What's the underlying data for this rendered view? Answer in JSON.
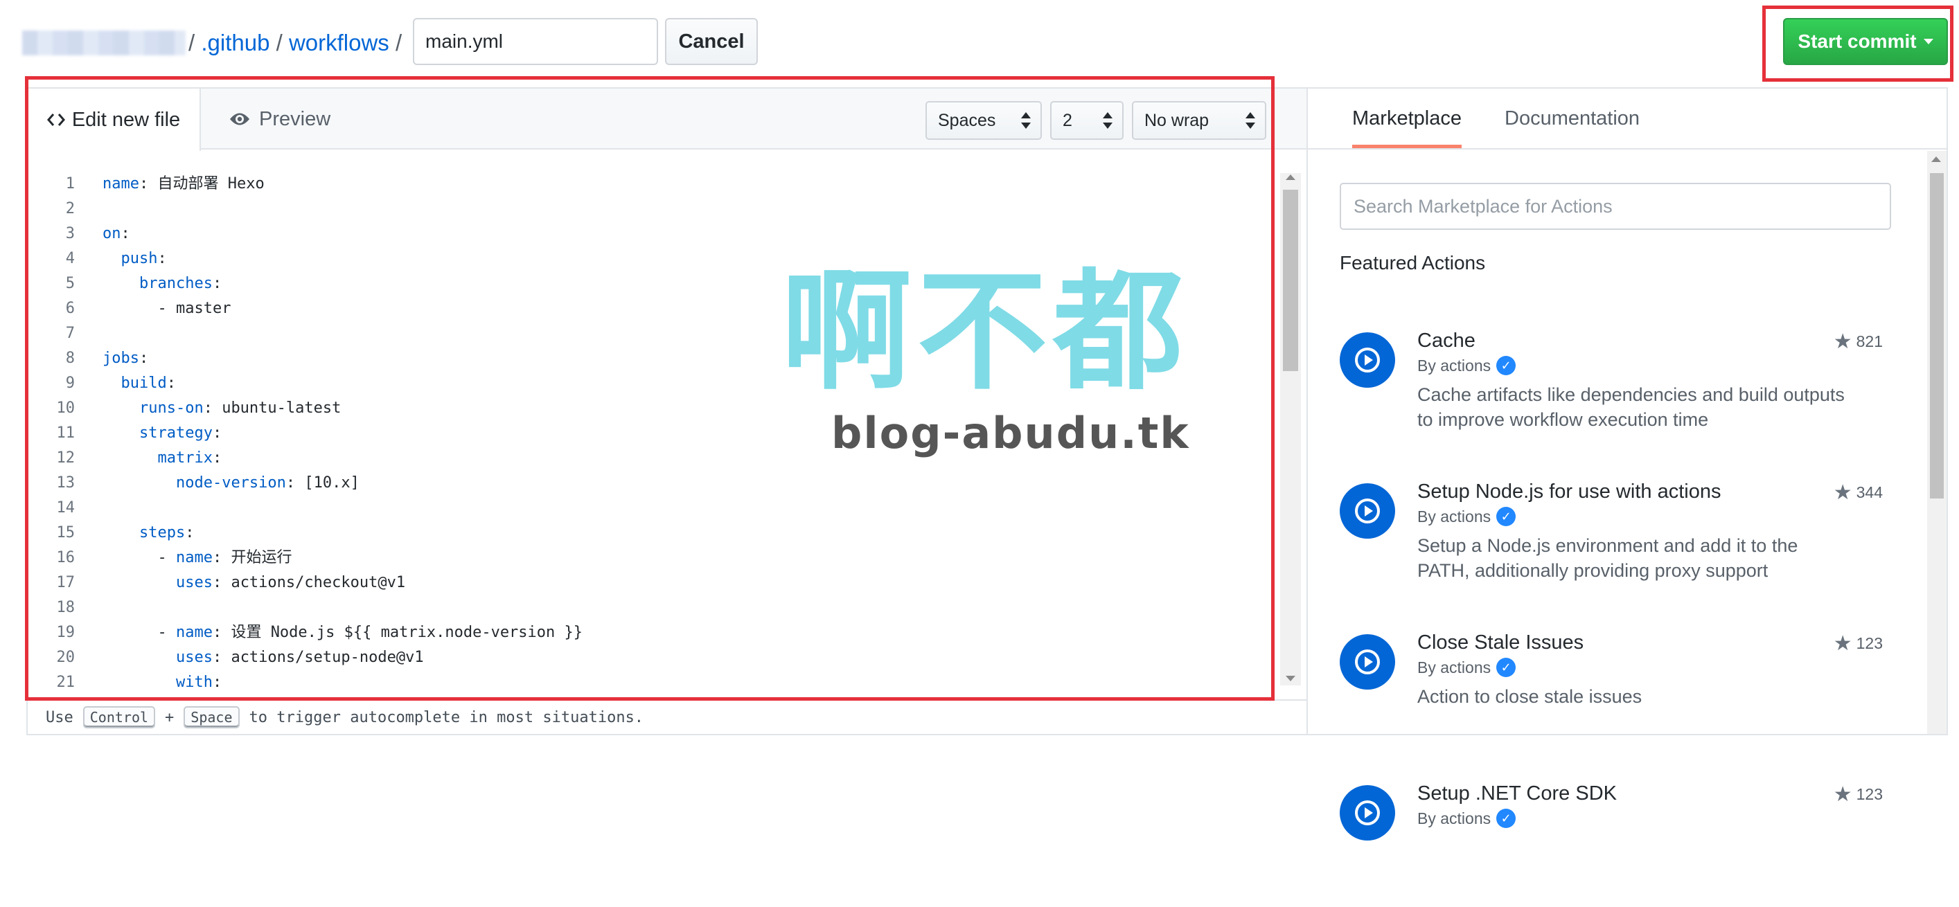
{
  "breadcrumb": {
    "repo_blurred": "",
    "separator": "/",
    "dir1": ".github",
    "dir2": "workflows"
  },
  "filename_input": {
    "value": "main.yml"
  },
  "buttons": {
    "cancel": "Cancel",
    "start_commit": "Start commit"
  },
  "editor": {
    "tabs": {
      "edit": "Edit new file",
      "preview": "Preview"
    },
    "indent_mode": "Spaces",
    "indent_size": "2",
    "wrap_mode": "No wrap",
    "lines": [
      {
        "n": "1",
        "indent": "",
        "key": "name",
        "rest": ": 自动部署 Hexo"
      },
      {
        "n": "2",
        "indent": "",
        "key": "",
        "rest": ""
      },
      {
        "n": "3",
        "indent": "",
        "key": "on",
        "rest": ":"
      },
      {
        "n": "4",
        "indent": "  ",
        "key": "push",
        "rest": ":"
      },
      {
        "n": "5",
        "indent": "    ",
        "key": "branches",
        "rest": ":"
      },
      {
        "n": "6",
        "indent": "      ",
        "key": "",
        "rest": "- master"
      },
      {
        "n": "7",
        "indent": "",
        "key": "",
        "rest": ""
      },
      {
        "n": "8",
        "indent": "",
        "key": "jobs",
        "rest": ":"
      },
      {
        "n": "9",
        "indent": "  ",
        "key": "build",
        "rest": ":"
      },
      {
        "n": "10",
        "indent": "    ",
        "key": "runs-on",
        "rest": ": ubuntu-latest"
      },
      {
        "n": "11",
        "indent": "    ",
        "key": "strategy",
        "rest": ":"
      },
      {
        "n": "12",
        "indent": "      ",
        "key": "matrix",
        "rest": ":"
      },
      {
        "n": "13",
        "indent": "        ",
        "key": "node-version",
        "rest": ": [10.x]"
      },
      {
        "n": "14",
        "indent": "",
        "key": "",
        "rest": ""
      },
      {
        "n": "15",
        "indent": "    ",
        "key": "steps",
        "rest": ":"
      },
      {
        "n": "16",
        "indent": "      - ",
        "key": "name",
        "rest": ": 开始运行"
      },
      {
        "n": "17",
        "indent": "        ",
        "key": "uses",
        "rest": ": actions/checkout@v1"
      },
      {
        "n": "18",
        "indent": "",
        "key": "",
        "rest": ""
      },
      {
        "n": "19",
        "indent": "      - ",
        "key": "name",
        "rest": ": 设置 Node.js ${{ matrix.node-version }}"
      },
      {
        "n": "20",
        "indent": "        ",
        "key": "uses",
        "rest": ": actions/setup-node@v1"
      },
      {
        "n": "21",
        "indent": "        ",
        "key": "with",
        "rest": ":"
      }
    ],
    "footer": {
      "use": "Use",
      "key1": "Control",
      "plus": "+",
      "key2": "Space",
      "tail": "to trigger autocomplete in most situations."
    }
  },
  "watermark": {
    "big": "啊不都",
    "small": "blog-abudu.tk"
  },
  "sidebar": {
    "tabs": {
      "marketplace": "Marketplace",
      "documentation": "Documentation"
    },
    "search_placeholder": "Search Marketplace for Actions",
    "featured_heading": "Featured Actions",
    "actions": [
      {
        "title": "Cache",
        "by": "By actions",
        "desc": "Cache artifacts like dependencies and build outputs to improve workflow execution time",
        "stars": "821"
      },
      {
        "title": "Setup Node.js for use with actions",
        "by": "By actions",
        "desc": "Setup a Node.js environment and add it to the PATH, additionally providing proxy support",
        "stars": "344"
      },
      {
        "title": "Close Stale Issues",
        "by": "By actions",
        "desc": "Action to close stale issues",
        "stars": "123"
      },
      {
        "title": "Setup .NET Core SDK",
        "by": "By actions",
        "desc": "",
        "stars": "123"
      }
    ]
  },
  "colors": {
    "link": "#0366d6",
    "commit_green": "#28a745",
    "highlight_red": "#e5303a",
    "yaml_key": "#005cc5",
    "watermark_cyan": "#7fdbe6"
  }
}
